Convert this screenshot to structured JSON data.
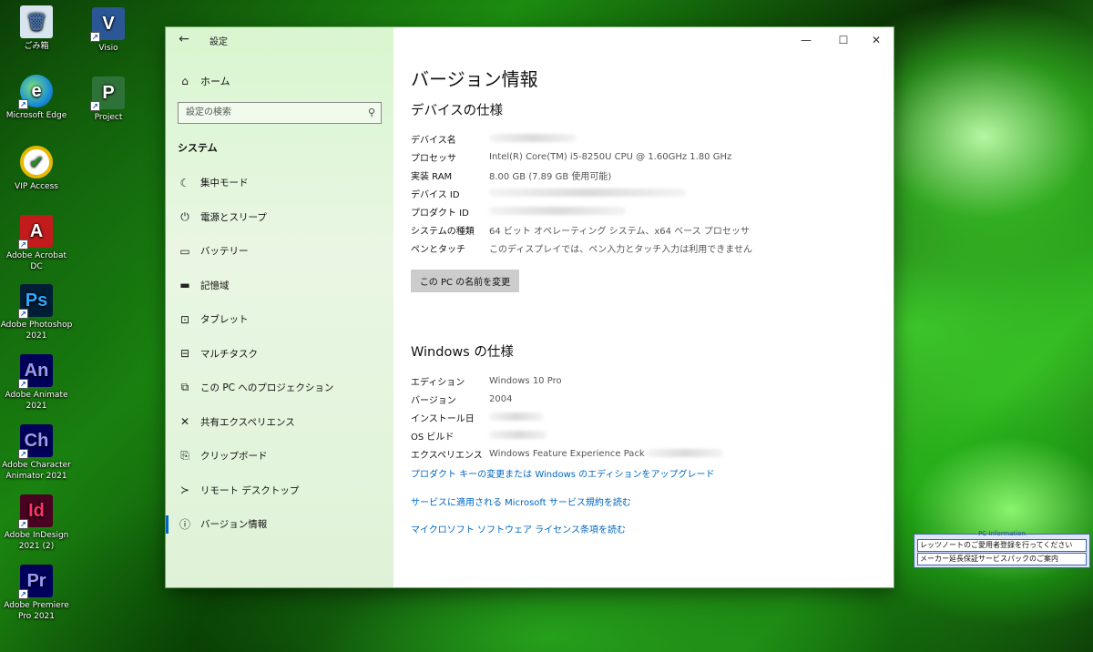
{
  "desktop": {
    "icons": [
      {
        "label": "ごみ箱",
        "glyph": "🗑",
        "icon": "recycle-bin-icon",
        "color": "#d8e4ee",
        "fg": "#4a6fa0"
      },
      {
        "label": "Microsoft Edge",
        "glyph": "e",
        "icon": "edge-icon",
        "color": "#1a8fd6",
        "fg": "#7fe07a"
      },
      {
        "label": "VIP Access",
        "glyph": "✔",
        "icon": "vip-access-icon",
        "color": "#ffffff",
        "fg": "#e6b800"
      },
      {
        "label": "Adobe Acrobat DC",
        "glyph": "A",
        "icon": "acrobat-icon",
        "color": "#c21b1b",
        "fg": "#ffffff"
      },
      {
        "label": "Adobe Photoshop 2021",
        "glyph": "Ps",
        "icon": "photoshop-icon",
        "color": "#001e36",
        "fg": "#31a8ff"
      },
      {
        "label": "Adobe Animate 2021",
        "glyph": "An",
        "icon": "animate-icon",
        "color": "#00005b",
        "fg": "#9999ff"
      },
      {
        "label": "Adobe Character Animator 2021",
        "glyph": "Ch",
        "icon": "character-animator-icon",
        "color": "#00005b",
        "fg": "#9999ff"
      },
      {
        "label": "Adobe InDesign 2021 (2)",
        "glyph": "Id",
        "icon": "indesign-icon",
        "color": "#49021f",
        "fg": "#ff3366"
      },
      {
        "label": "Adobe Premiere Pro 2021",
        "glyph": "Pr",
        "icon": "premiere-icon",
        "color": "#00005b",
        "fg": "#9999ff"
      },
      {
        "label": "Visio",
        "glyph": "V",
        "icon": "visio-icon",
        "color": "#2b5797",
        "fg": "#ffffff"
      },
      {
        "label": "Project",
        "glyph": "P",
        "icon": "project-icon",
        "color": "#2e7237",
        "fg": "#ffffff"
      }
    ]
  },
  "window": {
    "title": "設定",
    "back_glyph": "←",
    "minimize_glyph": "—",
    "maximize_glyph": "☐",
    "close_glyph": "✕"
  },
  "sidebar": {
    "home_label": "ホーム",
    "search_placeholder": "設定の検索",
    "section_label": "システム",
    "items": [
      {
        "label": "集中モード",
        "icon": "moon-icon",
        "glyph": "☾"
      },
      {
        "label": "電源とスリープ",
        "icon": "power-icon",
        "glyph": "⏻"
      },
      {
        "label": "バッテリー",
        "icon": "battery-icon",
        "glyph": "▭"
      },
      {
        "label": "記憶域",
        "icon": "storage-icon",
        "glyph": "▬"
      },
      {
        "label": "タブレット",
        "icon": "tablet-icon",
        "glyph": "⊡"
      },
      {
        "label": "マルチタスク",
        "icon": "multitask-icon",
        "glyph": "⊟"
      },
      {
        "label": "この PC へのプロジェクション",
        "icon": "projection-icon",
        "glyph": "⧉"
      },
      {
        "label": "共有エクスペリエンス",
        "icon": "shared-experience-icon",
        "glyph": "✕"
      },
      {
        "label": "クリップボード",
        "icon": "clipboard-icon",
        "glyph": "⎘"
      },
      {
        "label": "リモート デスクトップ",
        "icon": "remote-desktop-icon",
        "glyph": "≻"
      },
      {
        "label": "バージョン情報",
        "icon": "info-icon",
        "glyph": "ⓘ",
        "active": true
      }
    ]
  },
  "main": {
    "page_title": "バージョン情報",
    "device_spec": {
      "heading": "デバイスの仕様",
      "rows": [
        {
          "key": "デバイス名",
          "value": ""
        },
        {
          "key": "プロセッサ",
          "value": "Intel(R) Core(TM) i5-8250U CPU @ 1.60GHz   1.80 GHz"
        },
        {
          "key": "実装 RAM",
          "value": "8.00 GB (7.89 GB 使用可能)"
        },
        {
          "key": "デバイス ID",
          "value": ""
        },
        {
          "key": "プロダクト ID",
          "value": ""
        },
        {
          "key": "システムの種類",
          "value": "64 ビット オペレーティング システム、x64 ベース プロセッサ"
        },
        {
          "key": "ペンとタッチ",
          "value": "このディスプレイでは、ペン入力とタッチ入力は利用できません"
        }
      ],
      "rename_button": "この PC の名前を変更"
    },
    "windows_spec": {
      "heading": "Windows の仕様",
      "rows": [
        {
          "key": "エディション",
          "value": "Windows 10 Pro"
        },
        {
          "key": "バージョン",
          "value": "2004"
        },
        {
          "key": "インストール日",
          "value": ""
        },
        {
          "key": "OS ビルド",
          "value": ""
        },
        {
          "key": "エクスペリエンス",
          "value": "Windows Feature Experience Pack"
        }
      ]
    },
    "links": [
      "プロダクト キーの変更または Windows のエディションをアップグレード",
      "サービスに適用される Microsoft サービス規約を読む",
      "マイクロソフト ソフトウェア ライセンス条項を読む"
    ]
  },
  "pc_info": {
    "caption": "PC  Information",
    "lines": [
      "レッツノートのご愛用者登録を行ってください",
      "メーカー延長保証サービスパックのご案内"
    ]
  }
}
